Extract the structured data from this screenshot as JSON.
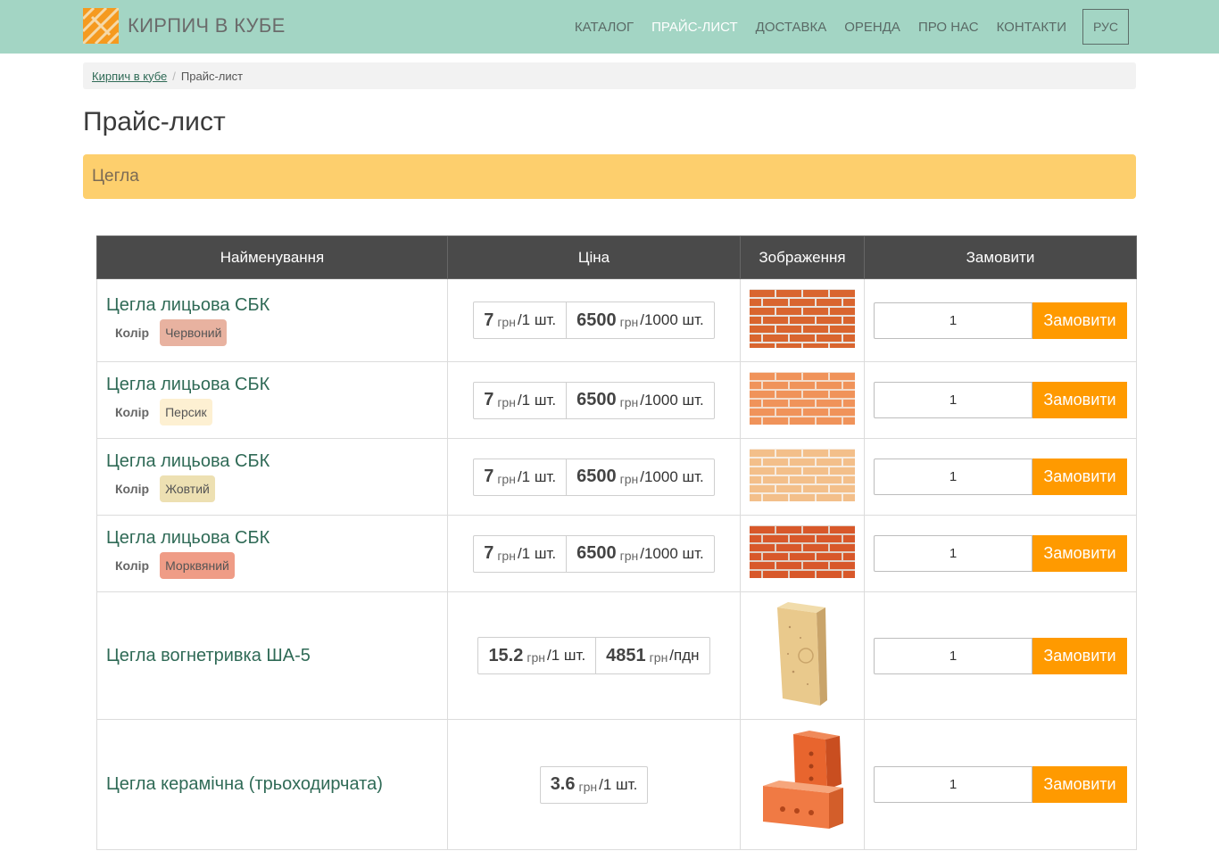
{
  "brand": {
    "name": "КИРПИЧ В КУБЕ"
  },
  "nav": {
    "items": [
      {
        "label": "КАТАЛОГ",
        "active": false
      },
      {
        "label": "ПРАЙС-ЛИСТ",
        "active": true
      },
      {
        "label": "ДОСТАВКА",
        "active": false
      },
      {
        "label": "ОРЕНДА",
        "active": false
      },
      {
        "label": "ПРО НАС",
        "active": false
      },
      {
        "label": "КОНТАКТИ",
        "active": false
      }
    ],
    "lang": "РУС"
  },
  "breadcrumb": {
    "home": "Кирпич в кубе",
    "sep": "/",
    "current": "Прайс-лист"
  },
  "page_title": "Прайс-лист",
  "section": "Цегла",
  "table": {
    "headers": [
      "Найменування",
      "Ціна",
      "Зображення",
      "Замовити"
    ],
    "color_label": "Колір",
    "order_label": "Замовити",
    "rows": [
      {
        "name": "Цегла лицьова СБК",
        "color": "Червоний",
        "badge_color": "#e8b2a0",
        "prices": [
          {
            "value": "7",
            "unit": "грн",
            "per": "/1 шт."
          },
          {
            "value": "6500",
            "unit": "грн",
            "per": "/1000 шт."
          }
        ],
        "qty": "1",
        "image": "brick-wall-red-icon"
      },
      {
        "name": "Цегла лицьова СБК",
        "color": "Персик",
        "badge_color": "#fdf0d2",
        "prices": [
          {
            "value": "7",
            "unit": "грн",
            "per": "/1 шт."
          },
          {
            "value": "6500",
            "unit": "грн",
            "per": "/1000 шт."
          }
        ],
        "qty": "1",
        "image": "brick-wall-peach-icon"
      },
      {
        "name": "Цегла лицьова СБК",
        "color": "Жовтий",
        "badge_color": "#ede0b2",
        "prices": [
          {
            "value": "7",
            "unit": "грн",
            "per": "/1 шт."
          },
          {
            "value": "6500",
            "unit": "грн",
            "per": "/1000 шт."
          }
        ],
        "qty": "1",
        "image": "brick-wall-yellow-icon"
      },
      {
        "name": "Цегла лицьова СБК",
        "color": "Морквяний",
        "badge_color": "#ef9c86",
        "prices": [
          {
            "value": "7",
            "unit": "грн",
            "per": "/1 шт."
          },
          {
            "value": "6500",
            "unit": "грн",
            "per": "/1000 шт."
          }
        ],
        "qty": "1",
        "image": "brick-wall-carrot-icon"
      },
      {
        "name": "Цегла вогнетривка ША-5",
        "prices": [
          {
            "value": "15.2",
            "unit": "грн",
            "per": "/1 шт."
          },
          {
            "value": "4851",
            "unit": "грн",
            "per": "/пдн"
          }
        ],
        "qty": "1",
        "image": "fireclay-brick-icon"
      },
      {
        "name": "Цегла керамічна (трьоходирчата)",
        "prices": [
          {
            "value": "3.6",
            "unit": "грн",
            "per": "/1 шт."
          }
        ],
        "qty": "1",
        "image": "ceramic-brick-icon"
      }
    ]
  },
  "colors": {
    "navbar": "#a3d5c4",
    "accent": "#ff9a00",
    "section": "#fdcf6d",
    "link": "#2f6a56",
    "table_header": "#4a4a4a"
  }
}
